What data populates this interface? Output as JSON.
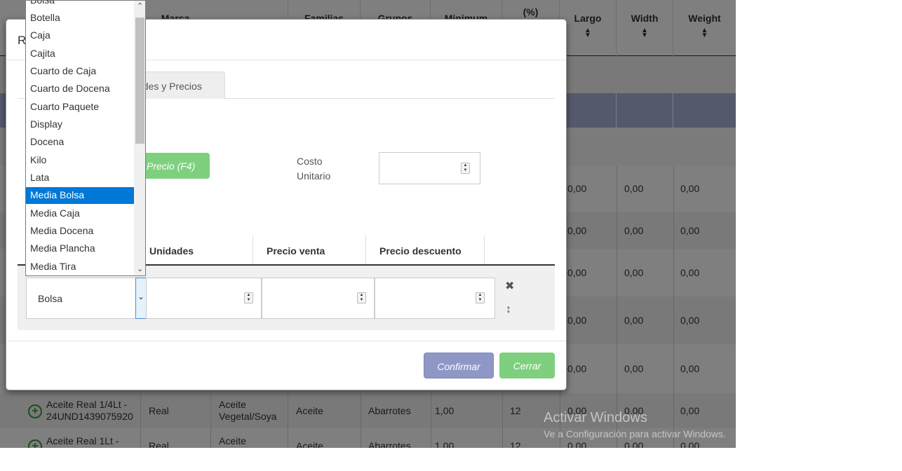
{
  "background_table": {
    "headers": [
      {
        "key": "marca",
        "label": "Marca"
      },
      {
        "key": "familias",
        "label": "Familias"
      },
      {
        "key": "grupos",
        "label": "Grupos"
      },
      {
        "key": "minimum",
        "label": "Minimum"
      },
      {
        "key": "pct",
        "label": "(%)"
      },
      {
        "key": "largo",
        "label": "Largo"
      },
      {
        "key": "width",
        "label": "Width"
      },
      {
        "key": "weight",
        "label": "Weight"
      }
    ],
    "zero": "0,00",
    "rows": [
      {
        "name_line1": "Aceite Real 1/4Lt -",
        "name_line2": "24UND1439075920",
        "marca": "Real",
        "familia_line1": "Aceite",
        "familia_line2": "Vegetal/Soya",
        "grupo": "Aceite",
        "cat": "Abarrotes",
        "minimum": "1,00",
        "pct": "12"
      },
      {
        "name_line1": "Aceite Real 1Lt -",
        "marca": "Real",
        "familia_line1": "Aceite",
        "grupo": "Aceite",
        "cat": "Abarrotes",
        "minimum": "1,00",
        "pct": "12"
      }
    ]
  },
  "watermark": {
    "line1": "Activar Windows",
    "line2": "Ve a Configuración para activar Windows."
  },
  "modal": {
    "title_partial": "R",
    "tab_label": "ades y Precios",
    "precio_button": "Precio (F4)",
    "costo_unitario_label": "Costo Unitario",
    "costo_unitario_value": "",
    "table_headers": {
      "unidades": "Unidades",
      "precio_venta": "Precio venta",
      "precio_descuento": "Precio descuento"
    },
    "row": {
      "unidad": "Bolsa",
      "unidades": "",
      "precio_venta": "",
      "precio_descuento": ""
    },
    "confirm_button": "Confirmar",
    "close_button": "Cerrar"
  },
  "dropdown": {
    "options": [
      "Bolsa",
      "Botella",
      "Caja",
      "Cajita",
      "Cuarto de Caja",
      "Cuarto de Docena",
      "Cuarto Paquete",
      "Display",
      "Docena",
      "Kilo",
      "Lata",
      "Media Bolsa",
      "Media Caja",
      "Media Docena",
      "Media Plancha",
      "Media Tira"
    ],
    "highlighted": "Media Bolsa"
  },
  "icons": {
    "sort": "sort-arrows-icon",
    "delete": "close-icon",
    "move": "vertical-move-icon",
    "add": "plus-circle-icon"
  }
}
